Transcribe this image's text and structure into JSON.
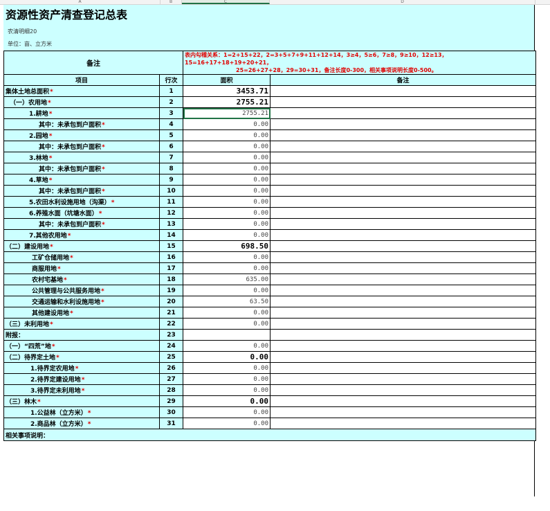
{
  "columns": [
    "A",
    "B",
    "C",
    "D"
  ],
  "title": "资源性资产清查登记总表",
  "subtitle1": "农清明细20",
  "subtitle2": "单位：亩、立方米",
  "notes_label": "备注",
  "notes_lines": [
    "表内勾稽关系：1=2+15+22，2=3+5+7+9+11+12+14，3≥4，5≥6，7≥8，9≥10，12≥13，",
    "15=16+17+18+19+20+21，",
    "25=26+27+28，29=30+31，备注长度0-300，相关事项说明长度0-500。"
  ],
  "headers": {
    "item": "项目",
    "line": "行次",
    "area": "面积",
    "note": "备注"
  },
  "required_mark": "*",
  "rows": [
    {
      "label": "集体土地总面积",
      "line": "1",
      "value": "3453.71"
    },
    {
      "label": "（一）农用地",
      "line": "2",
      "value": "2755.21"
    },
    {
      "label": "1.耕地",
      "line": "3",
      "value": "2755.21"
    },
    {
      "label": "其中：未承包到户面积",
      "line": "4",
      "value": "0.00"
    },
    {
      "label": "2.园地",
      "line": "5",
      "value": "0.00"
    },
    {
      "label": "其中：未承包到户面积",
      "line": "6",
      "value": "0.00"
    },
    {
      "label": "3.林地",
      "line": "7",
      "value": "0.00"
    },
    {
      "label": "其中：未承包到户面积",
      "line": "8",
      "value": "0.00"
    },
    {
      "label": "4.草地",
      "line": "9",
      "value": "0.00"
    },
    {
      "label": "其中：未承包到户面积",
      "line": "10",
      "value": "0.00"
    },
    {
      "label": "5.农田水利设施用地（沟渠）",
      "line": "11",
      "value": "0.00"
    },
    {
      "label": "6.养殖水面（坑塘水面）",
      "line": "12",
      "value": "0.00"
    },
    {
      "label": "其中：未承包到户面积",
      "line": "13",
      "value": "0.00"
    },
    {
      "label": "7.其他农用地",
      "line": "14",
      "value": "0.00"
    },
    {
      "label": "（二）建设用地",
      "line": "15",
      "value": "698.50"
    },
    {
      "label": "工矿仓储用地",
      "line": "16",
      "value": "0.00"
    },
    {
      "label": "商服用地",
      "line": "17",
      "value": "0.00"
    },
    {
      "label": "农村宅基地",
      "line": "18",
      "value": "635.00"
    },
    {
      "label": "公共管理与公共服务用地",
      "line": "19",
      "value": "0.00"
    },
    {
      "label": "交通运输和水利设施用地",
      "line": "20",
      "value": "63.50"
    },
    {
      "label": "其他建设用地",
      "line": "21",
      "value": "0.00"
    },
    {
      "label": "（三）未利用地",
      "line": "22",
      "value": "0.00"
    },
    {
      "label": "附报：",
      "line": "23",
      "value": ""
    },
    {
      "label": "（一）“四荒”地",
      "line": "24",
      "value": "0.00"
    },
    {
      "label": "（二）待界定土地",
      "line": "25",
      "value": "0.00"
    },
    {
      "label": "1.待界定农用地",
      "line": "26",
      "value": "0.00"
    },
    {
      "label": "2.待界定建设用地",
      "line": "27",
      "value": "0.00"
    },
    {
      "label": "3.待界定未利用地",
      "line": "28",
      "value": "0.00"
    },
    {
      "label": "（三）林木",
      "line": "29",
      "value": "0.00"
    },
    {
      "label": "1.公益林（立方米）",
      "line": "30",
      "value": "0.00"
    },
    {
      "label": "2.商品林（立方米）",
      "line": "31",
      "value": "0.00"
    }
  ],
  "explain_label": "相关事项说明："
}
